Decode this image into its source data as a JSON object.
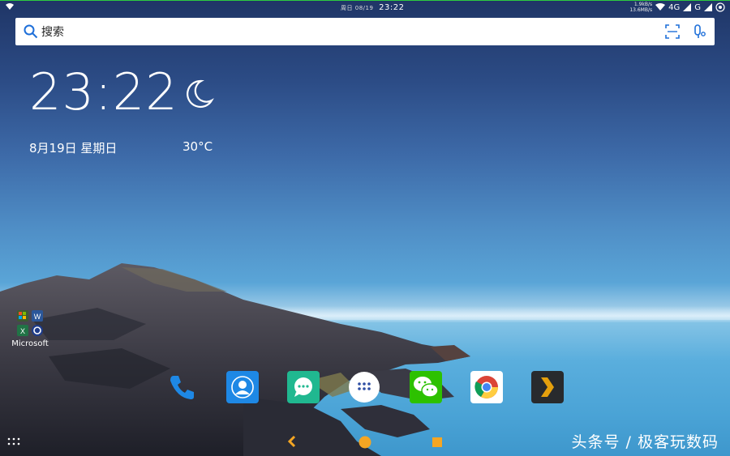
{
  "status_bar": {
    "carrier_left": "周日",
    "date": "08/19",
    "time": "23:22",
    "upload_speed": "1.9kB/s",
    "download_speed": "13.6MB/s",
    "network_label": "4G",
    "network_label2": "G"
  },
  "search": {
    "placeholder": "搜索"
  },
  "clock_widget": {
    "time": "23:22",
    "date": "8月19日 星期日",
    "temperature": "30°C"
  },
  "desktop": {
    "folder_label": "Microsoft"
  },
  "dock": {
    "apps": [
      "phone-icon",
      "contacts-icon",
      "messages-icon",
      "app-drawer-icon",
      "wechat-icon",
      "chrome-icon",
      "plex-icon"
    ]
  },
  "watermark": "头条号 / 极客玩数码",
  "colors": {
    "nav_accent": "#f5a623",
    "wechat": "#2dc100",
    "contacts": "#1e88e5",
    "messages": "#20b890"
  }
}
